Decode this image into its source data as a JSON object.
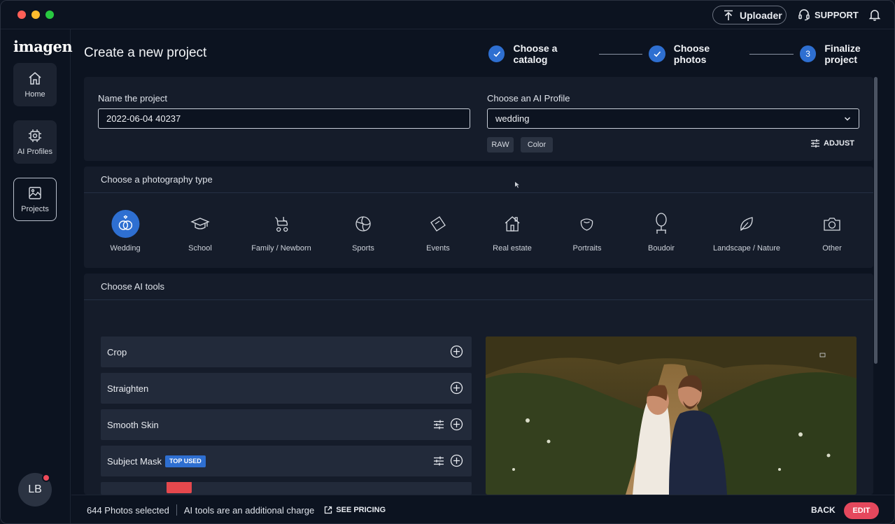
{
  "titlebar": {
    "uploader_label": "Uploader",
    "support_label": "SUPPORT"
  },
  "sidebar": {
    "logo": "imagen",
    "items": [
      {
        "label": "Home",
        "icon": "home-icon"
      },
      {
        "label": "AI Profiles",
        "icon": "ai-chip-icon"
      },
      {
        "label": "Projects",
        "icon": "projects-icon",
        "active": true
      }
    ],
    "avatar_initials": "LB"
  },
  "header": {
    "title": "Create a new project"
  },
  "stepper": [
    {
      "label": "Choose a catalog",
      "state": "done"
    },
    {
      "label": "Choose photos",
      "state": "done"
    },
    {
      "number": "3",
      "label": "Finalize project",
      "state": "current"
    }
  ],
  "project": {
    "name_label": "Name the project",
    "name_value": "2022-06-04 40237",
    "profile_label": "Choose an AI Profile",
    "profile_value": "wedding",
    "chips": [
      "RAW",
      "Color"
    ],
    "adjust_label": "ADJUST"
  },
  "photography_type": {
    "header": "Choose a photography type",
    "selected": "Wedding",
    "types": [
      {
        "label": "Wedding",
        "icon": "rings-icon"
      },
      {
        "label": "School",
        "icon": "graduation-cap-icon"
      },
      {
        "label": "Family / Newborn",
        "icon": "stroller-icon"
      },
      {
        "label": "Sports",
        "icon": "ball-icon"
      },
      {
        "label": "Events",
        "icon": "ticket-icon"
      },
      {
        "label": "Real estate",
        "icon": "house-icon"
      },
      {
        "label": "Portraits",
        "icon": "portrait-icon"
      },
      {
        "label": "Boudoir",
        "icon": "mirror-icon"
      },
      {
        "label": "Landscape / Nature",
        "icon": "leaf-icon"
      },
      {
        "label": "Other",
        "icon": "camera-icon"
      }
    ]
  },
  "ai_tools": {
    "header": "Choose AI tools",
    "tools": [
      {
        "label": "Crop",
        "has_settings": false
      },
      {
        "label": "Straighten",
        "has_settings": false
      },
      {
        "label": "Smooth Skin",
        "has_settings": true
      },
      {
        "label": "Subject Mask",
        "has_settings": true,
        "badge": "TOP USED"
      },
      {
        "label": "",
        "has_settings": true,
        "badge_color": "#e5484d"
      }
    ]
  },
  "bottombar": {
    "count": "644 Photos selected",
    "charge_note": "AI tools are an additional charge",
    "pricing_label": "SEE PRICING",
    "back_label": "BACK",
    "edit_label": "EDIT"
  },
  "colors": {
    "accent": "#2e6fd1",
    "edit_button": "#e5485d",
    "background": "#0c1320",
    "panel": "#151c2a"
  }
}
